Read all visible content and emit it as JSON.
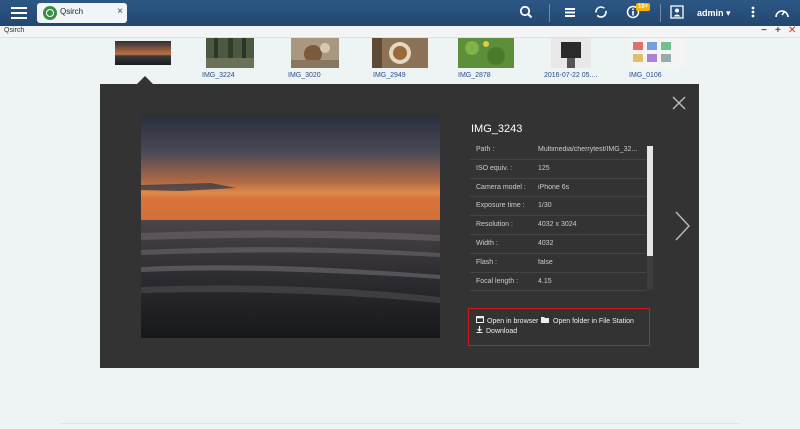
{
  "topbar": {
    "tab_label": "Qsirch",
    "tab_close": "×",
    "badge": "10+",
    "user": "admin ▾"
  },
  "window": {
    "title": "Qsirch",
    "minimize": "−",
    "maximize": "+",
    "close": "✕"
  },
  "thumbnails": [
    {
      "label": ""
    },
    {
      "label": "IMG_3224"
    },
    {
      "label": "IMG_3020"
    },
    {
      "label": "IMG_2949"
    },
    {
      "label": "IMG_2878"
    },
    {
      "label": "2016-07-22 05...."
    },
    {
      "label": "IMG_0106"
    }
  ],
  "detail": {
    "title": "IMG_3243",
    "rows": [
      {
        "key": "Path :",
        "value": "Multimedia/cherrytest/IMG_32..."
      },
      {
        "key": "ISO equiv. :",
        "value": "125"
      },
      {
        "key": "Camera model :",
        "value": "iPhone 6s"
      },
      {
        "key": "Exposure time :",
        "value": "1/30"
      },
      {
        "key": "Resolution :",
        "value": "4032 x 3024"
      },
      {
        "key": "Width :",
        "value": "4032"
      },
      {
        "key": "Flash :",
        "value": "false"
      },
      {
        "key": "Focal length :",
        "value": "4.15"
      }
    ],
    "actions": {
      "open_browser": "Open in browser",
      "open_folder": "Open folder in File Station",
      "download": "Download"
    }
  },
  "colors": {
    "topbar": "#284d7a",
    "panel": "#333333",
    "highlight": "#d0191b",
    "link": "#2b4e8c"
  }
}
